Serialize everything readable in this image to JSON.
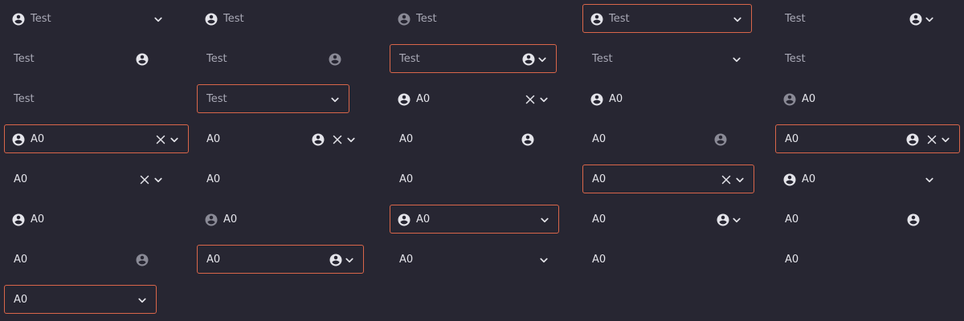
{
  "theme": {
    "background": "#272632",
    "focus_border": "#d9664a",
    "text": "#e6e6ec",
    "placeholder": "#a9a9b6",
    "icon": "#e4e4ea",
    "icon_dim": "#8a8a96"
  },
  "fields": [
    {
      "text": "Test",
      "placeholder": true,
      "lead_icon": "account-circle-icon",
      "clear": false,
      "user_icon": false,
      "chevron": true,
      "selected": false
    },
    {
      "text": "Test",
      "placeholder": true,
      "lead_icon": "account-circle-icon",
      "clear": false,
      "user_icon": false,
      "chevron": false,
      "selected": false
    },
    {
      "text": "Test",
      "placeholder": true,
      "lead_icon": "account-circle-icon",
      "lead_dim": true,
      "clear": false,
      "user_icon": false,
      "chevron": false,
      "selected": false
    },
    {
      "text": "Test",
      "placeholder": true,
      "lead_icon": "account-circle-icon",
      "clear": false,
      "user_icon": false,
      "chevron": true,
      "selected": true
    },
    {
      "text": "Test",
      "placeholder": true,
      "lead_icon": null,
      "clear": false,
      "user_icon": true,
      "chevron": true,
      "selected": false
    },
    {
      "text": "Test",
      "placeholder": true,
      "lead_icon": null,
      "clear": false,
      "user_icon": true,
      "chevron": false,
      "selected": false
    },
    {
      "text": "Test",
      "placeholder": true,
      "lead_icon": null,
      "clear": false,
      "user_icon": true,
      "user_dim": true,
      "chevron": false,
      "selected": false
    },
    {
      "text": "Test",
      "placeholder": true,
      "lead_icon": null,
      "clear": false,
      "user_icon": true,
      "chevron": true,
      "selected": true
    },
    {
      "text": "Test",
      "placeholder": true,
      "lead_icon": null,
      "clear": false,
      "user_icon": false,
      "chevron": true,
      "selected": false
    },
    {
      "text": "Test",
      "placeholder": true,
      "lead_icon": null,
      "clear": false,
      "user_icon": false,
      "chevron": false,
      "selected": false
    },
    {
      "text": "Test",
      "placeholder": true,
      "lead_icon": null,
      "clear": false,
      "user_icon": false,
      "chevron": false,
      "selected": false
    },
    {
      "text": "Test",
      "placeholder": true,
      "lead_icon": null,
      "clear": false,
      "user_icon": false,
      "chevron": true,
      "selected": true
    },
    {
      "text": "A0",
      "placeholder": false,
      "lead_icon": "account-circle-icon",
      "clear": true,
      "user_icon": false,
      "chevron": true,
      "selected": false
    },
    {
      "text": "A0",
      "placeholder": false,
      "lead_icon": "account-circle-icon",
      "clear": false,
      "user_icon": false,
      "chevron": false,
      "selected": false
    },
    {
      "text": "A0",
      "placeholder": false,
      "lead_icon": "account-circle-icon",
      "lead_dim": true,
      "clear": false,
      "user_icon": false,
      "chevron": false,
      "selected": false
    },
    {
      "text": "A0",
      "placeholder": false,
      "lead_icon": "account-circle-icon",
      "clear": true,
      "user_icon": false,
      "chevron": true,
      "selected": true
    },
    {
      "text": "A0",
      "placeholder": false,
      "lead_icon": null,
      "clear": true,
      "user_icon": true,
      "chevron": true,
      "selected": false
    },
    {
      "text": "A0",
      "placeholder": false,
      "lead_icon": null,
      "clear": false,
      "user_icon": true,
      "chevron": false,
      "selected": false
    },
    {
      "text": "A0",
      "placeholder": false,
      "lead_icon": null,
      "clear": false,
      "user_icon": true,
      "user_dim": true,
      "chevron": false,
      "selected": false
    },
    {
      "text": "A0",
      "placeholder": false,
      "lead_icon": null,
      "clear": true,
      "user_icon": true,
      "chevron": true,
      "selected": true
    },
    {
      "text": "A0",
      "placeholder": false,
      "lead_icon": null,
      "clear": true,
      "user_icon": false,
      "chevron": true,
      "selected": false
    },
    {
      "text": "A0",
      "placeholder": false,
      "lead_icon": null,
      "clear": false,
      "user_icon": false,
      "chevron": false,
      "selected": false
    },
    {
      "text": "A0",
      "placeholder": false,
      "lead_icon": null,
      "clear": false,
      "user_icon": false,
      "chevron": false,
      "selected": false
    },
    {
      "text": "A0",
      "placeholder": false,
      "lead_icon": null,
      "clear": true,
      "user_icon": false,
      "chevron": true,
      "selected": true
    },
    {
      "text": "A0",
      "placeholder": false,
      "lead_icon": "account-circle-icon",
      "clear": false,
      "user_icon": false,
      "chevron": true,
      "selected": false
    },
    {
      "text": "A0",
      "placeholder": false,
      "lead_icon": "account-circle-icon",
      "clear": false,
      "user_icon": false,
      "chevron": false,
      "selected": false
    },
    {
      "text": "A0",
      "placeholder": false,
      "lead_icon": "account-circle-icon",
      "lead_dim": true,
      "clear": false,
      "user_icon": false,
      "chevron": false,
      "selected": false
    },
    {
      "text": "A0",
      "placeholder": false,
      "lead_icon": "account-circle-icon",
      "clear": false,
      "user_icon": false,
      "chevron": true,
      "selected": true
    },
    {
      "text": "A0",
      "placeholder": false,
      "lead_icon": null,
      "clear": false,
      "user_icon": true,
      "chevron": true,
      "selected": false
    },
    {
      "text": "A0",
      "placeholder": false,
      "lead_icon": null,
      "clear": false,
      "user_icon": true,
      "chevron": false,
      "selected": false
    },
    {
      "text": "A0",
      "placeholder": false,
      "lead_icon": null,
      "clear": false,
      "user_icon": true,
      "user_dim": true,
      "chevron": false,
      "selected": false
    },
    {
      "text": "A0",
      "placeholder": false,
      "lead_icon": null,
      "clear": false,
      "user_icon": true,
      "chevron": true,
      "selected": true
    },
    {
      "text": "A0",
      "placeholder": false,
      "lead_icon": null,
      "clear": false,
      "user_icon": false,
      "chevron": true,
      "selected": false
    },
    {
      "text": "A0",
      "placeholder": false,
      "lead_icon": null,
      "clear": false,
      "user_icon": false,
      "chevron": false,
      "selected": false
    },
    {
      "text": "A0",
      "placeholder": false,
      "lead_icon": null,
      "clear": false,
      "user_icon": false,
      "chevron": false,
      "selected": false
    },
    {
      "text": "A0",
      "placeholder": false,
      "lead_icon": null,
      "clear": false,
      "user_icon": false,
      "chevron": true,
      "selected": true
    }
  ]
}
